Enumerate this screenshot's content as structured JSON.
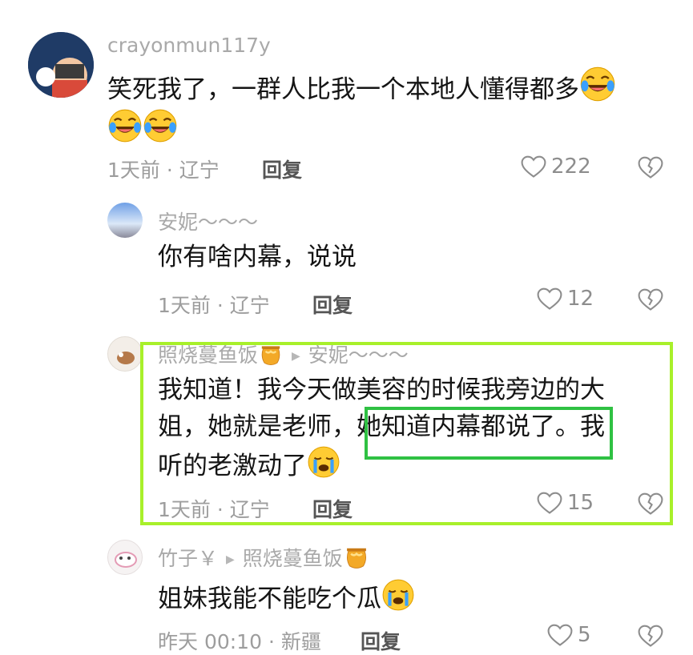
{
  "comments": [
    {
      "username": "crayonmun117y",
      "text_line1": "笑死我了，一群人比我一个本地人懂得都多",
      "meta": "1天前 · 辽宁",
      "reply_label": "回复",
      "likes": "222"
    },
    {
      "username": "安妮～～～",
      "text": "你有啥内幕，说说",
      "meta": "1天前 · 辽宁",
      "reply_label": "回复",
      "likes": "12"
    },
    {
      "username": "照烧蔓鱼饭",
      "reply_to": "安妮～～～",
      "text_line1": "我知道！我今天做美容的时候我旁边的大",
      "text_line2_a": "姐，她就是老师，",
      "text_line2_b": "她知道内幕都说了。",
      "text_line2_c": "我",
      "text_line3": "听的老激动了",
      "meta": "1天前 · 辽宁",
      "reply_label": "回复",
      "likes": "15"
    },
    {
      "username": "竹子￥",
      "reply_to": "照烧蔓鱼饭",
      "text": "姐妹我能不能吃个瓜",
      "meta": "昨天 00:10 · 新疆",
      "reply_label": "回复",
      "likes": "5"
    }
  ],
  "colors": {
    "highlight_outer": "#a8f02a",
    "highlight_inner": "#2fc143"
  },
  "icons": [
    "laughing-tears-emoji",
    "crying-emoji",
    "honey-pot-emoji",
    "heart-outline-icon",
    "broken-heart-icon",
    "play-arrow-icon"
  ]
}
